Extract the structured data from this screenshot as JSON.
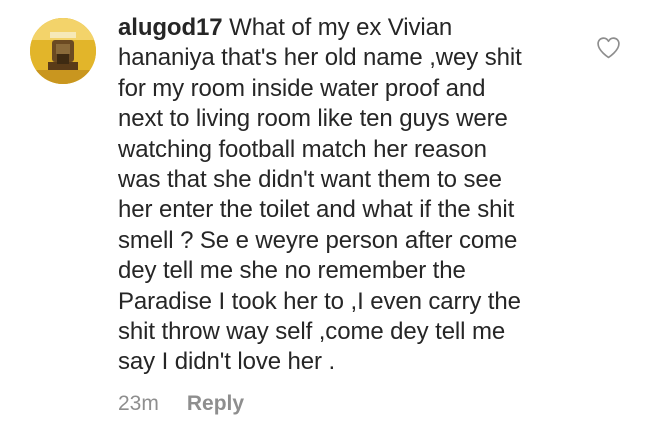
{
  "comment": {
    "username": "alugod17",
    "lines": [
      "What of my ex Vivian",
      "hananiya that's her old name ,wey shit",
      "for my room inside water proof and",
      "next to living room like ten guys were",
      "watching football match her reason",
      "was that she didn't want them to see",
      "her enter the toilet and what if the shit",
      "smell ? Se e weyre person after come",
      "dey tell me she no remember the",
      "Paradise I took her to ,I even carry the",
      "shit throw way self ,come dey tell me",
      "say I didn't love her ."
    ],
    "timestamp": "23m",
    "reply_label": "Reply",
    "like_icon": "heart-outline-icon",
    "colors": {
      "text": "#262626",
      "secondary": "#8e8e8e",
      "avatar_bg": "#e2b52a"
    }
  }
}
